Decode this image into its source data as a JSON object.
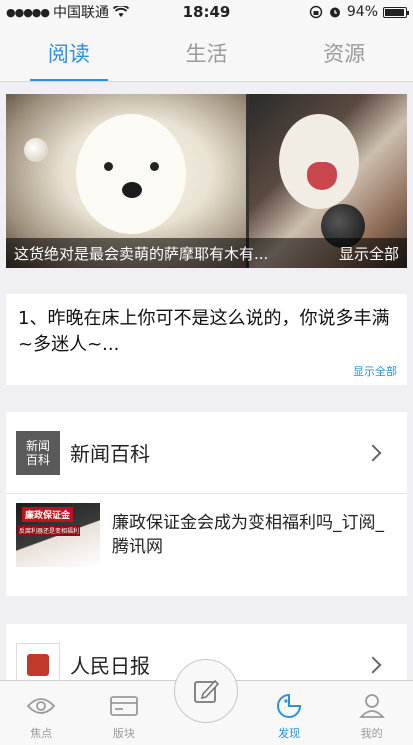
{
  "status_bar": {
    "carrier": "中国联通",
    "time": "18:49",
    "battery": "94%",
    "battery_level": 0.94
  },
  "top_tabs": [
    {
      "label": "阅读",
      "active": true
    },
    {
      "label": "生活",
      "active": false
    },
    {
      "label": "资源",
      "active": false
    }
  ],
  "banner": {
    "caption": "这货绝对是最会卖萌的萨摩耶有木有...",
    "more_label": "显示全部"
  },
  "joke": {
    "text": "1、昨晚在床上你可不是这么说的，你说多丰满~多迷人~...",
    "more_label": "显示全部"
  },
  "sections": [
    {
      "name": "新闻百科",
      "logo_text": "新闻百科",
      "article": {
        "title": "廉政保证金会成为变相福利吗_订阅_腾讯网",
        "thumb_title": "廉政保证金",
        "thumb_sub": "反腐利器还是变相福利"
      }
    },
    {
      "name": "人民日报"
    }
  ],
  "tab_bar": [
    {
      "label": "焦点",
      "icon": "eye-icon",
      "active": false
    },
    {
      "label": "版块",
      "icon": "card-icon",
      "active": false
    },
    {
      "label": "",
      "icon": "compose-icon",
      "active": false
    },
    {
      "label": "发现",
      "icon": "discover-icon",
      "active": true
    },
    {
      "label": "我的",
      "icon": "person-icon",
      "active": false
    }
  ],
  "colors": {
    "accent": "#2e8fe0",
    "inactive": "#9a9a9a",
    "background": "#efeff4"
  }
}
